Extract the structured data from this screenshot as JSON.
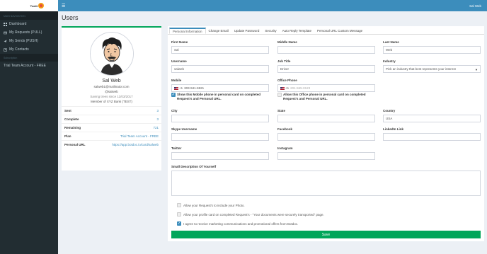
{
  "sidebar": {
    "logo_text": "Textit",
    "nav_header": "MAIN NAVIGATION",
    "items": [
      {
        "label": "Dashboard",
        "icon": "dashboard-icon"
      },
      {
        "label": "My Requests (PULL)",
        "icon": "inbox-icon"
      },
      {
        "label": "My Sends (PUSH)",
        "icon": "send-icon"
      },
      {
        "label": "My Contacts",
        "icon": "contacts-icon"
      }
    ],
    "subscription_header": "Subscription",
    "subscription_item": "Trial Team Account - FREE"
  },
  "topbar": {
    "menu_icon": "hamburger-icon",
    "user": "Sal Web"
  },
  "page": {
    "title": "Users"
  },
  "profile": {
    "name": "Sal Web",
    "email": "salweb1@mailinator.com",
    "handle": "@salweb",
    "since": "Saving trees since 11/03/2017",
    "member": "Member of XYZ Bank (TEST)",
    "rows": [
      {
        "key": "Sent",
        "value": "3"
      },
      {
        "key": "Complete",
        "value": "3"
      },
      {
        "key": "Remaining",
        "value": "721"
      },
      {
        "key": "Plan",
        "value": "Trial Team Account - FREE"
      },
      {
        "key": "Personal URL",
        "value": "https://app.botdoc.io/card/salweb"
      }
    ]
  },
  "tabs": [
    "Personal Information",
    "Change Email",
    "Update Password",
    "Security",
    "Auto Reply Template",
    "Personal URL Custom Message"
  ],
  "form": {
    "first_name": {
      "label": "First Name",
      "value": "Sal"
    },
    "middle_name": {
      "label": "Middle Name",
      "value": ""
    },
    "last_name": {
      "label": "Last Name",
      "value": "Web"
    },
    "username": {
      "label": "Username",
      "value": "salweb"
    },
    "job_title": {
      "label": "Job Title",
      "value": "Driver"
    },
    "industry": {
      "label": "Industry",
      "value": "Pick an industry that best represents your interest"
    },
    "mobile": {
      "label": "Mobile",
      "dial": "+1",
      "value": "303-941-6921"
    },
    "office_phone": {
      "label": "Office Phone",
      "dial": "+1",
      "placeholder": "201-555-0123"
    },
    "mobile_check": "Show this Mobile phone in personal card on completed Request's and Personal URL.",
    "office_check": "Allow this Office phone in personal card on completed Request's and Personal URL.",
    "city": {
      "label": "City",
      "value": ""
    },
    "state": {
      "label": "State",
      "value": ""
    },
    "country": {
      "label": "Country",
      "value": "USA"
    },
    "skype": {
      "label": "Skype Username",
      "value": ""
    },
    "facebook": {
      "label": "Facebook",
      "value": ""
    },
    "linkedin": {
      "label": "LinkedIn Link",
      "value": ""
    },
    "twitter": {
      "label": "Twitter",
      "value": ""
    },
    "instagram": {
      "label": "Instagram",
      "value": ""
    },
    "description": {
      "label": "Small Description Of Yourself",
      "value": ""
    },
    "opt_photo": "Allow your Request's to include your Photo.",
    "opt_card": "Allow your profile card on completed Request's - \"Your documents were securely transported\" page.",
    "opt_marketing": "I agree to receive marketing communications and promotional offers from Botdoc.",
    "save_label": "Save"
  },
  "colors": {
    "primary": "#3c8dbc",
    "success": "#00a65a",
    "sidebar": "#222d32"
  }
}
